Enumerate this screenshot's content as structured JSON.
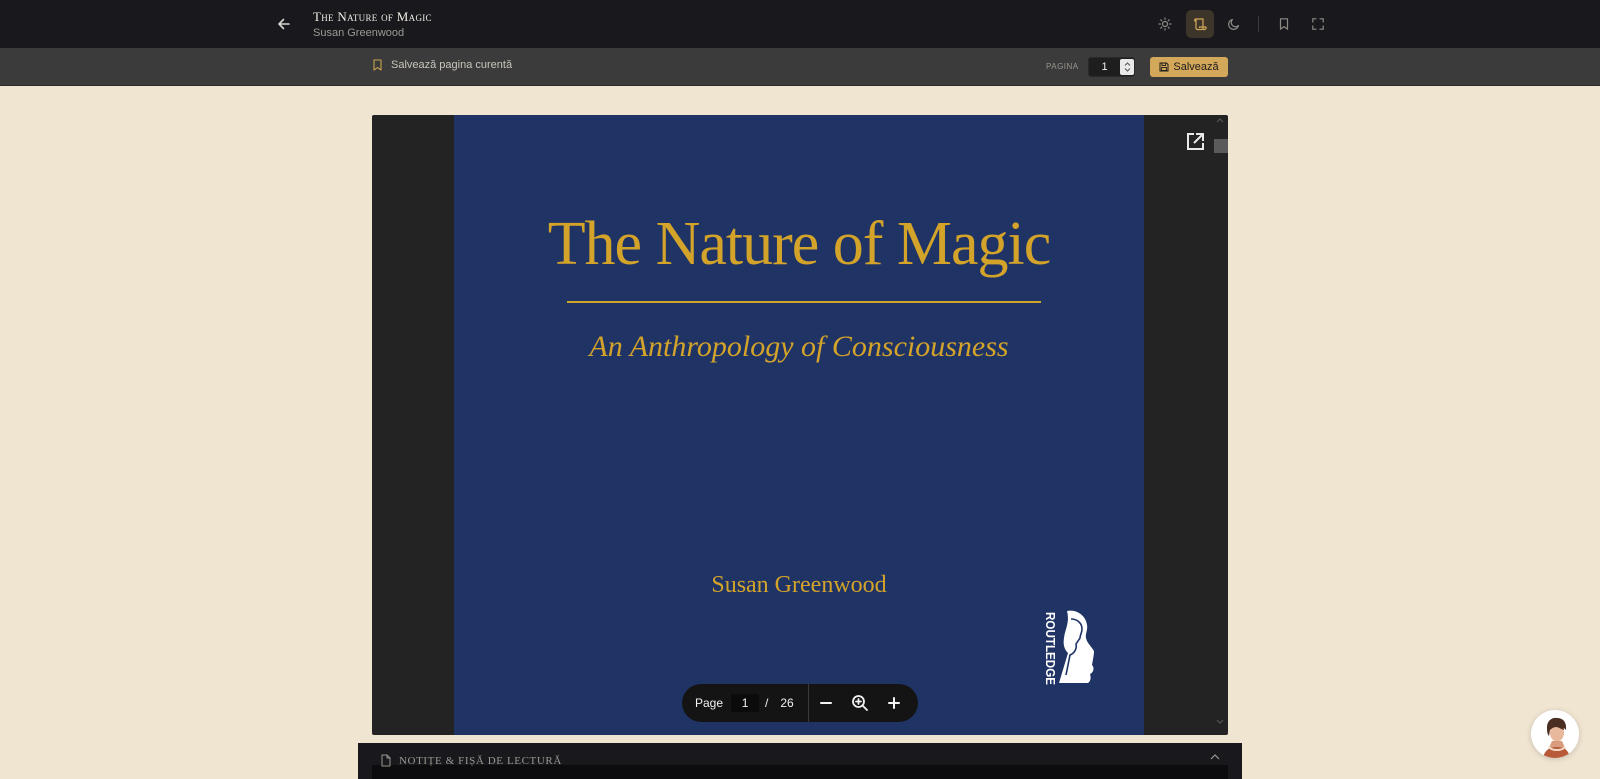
{
  "header": {
    "book_title": "The Nature of Magic",
    "book_author": "Susan Greenwood",
    "icons": [
      "arrow-left-icon",
      "sun-icon",
      "scroll-icon",
      "moon-icon",
      "bookmark-icon",
      "fullscreen-icon"
    ]
  },
  "toolbar": {
    "save_current_label": "Salvează pagina curentă",
    "page_label": "PAGINA",
    "page_value": "1",
    "save_label": "Salvează"
  },
  "cover": {
    "title": "The Nature of Magic",
    "subtitle": "An Anthropology of Consciousness",
    "author": "Susan Greenwood",
    "publisher": "ROUTLEDGE"
  },
  "pdf_controls": {
    "page_label": "Page",
    "current_page": "1",
    "separator": "/",
    "total_pages": "26"
  },
  "notes": {
    "title": "Notițe & fișă de lectură"
  },
  "colors": {
    "header_bg": "#18181d",
    "toolbar_bg": "#3b3b3b",
    "page_bg": "#f0e5d1",
    "accent": "#d4a85a",
    "cover_bg": "#1f3465",
    "cover_gold": "#d4a32a"
  }
}
